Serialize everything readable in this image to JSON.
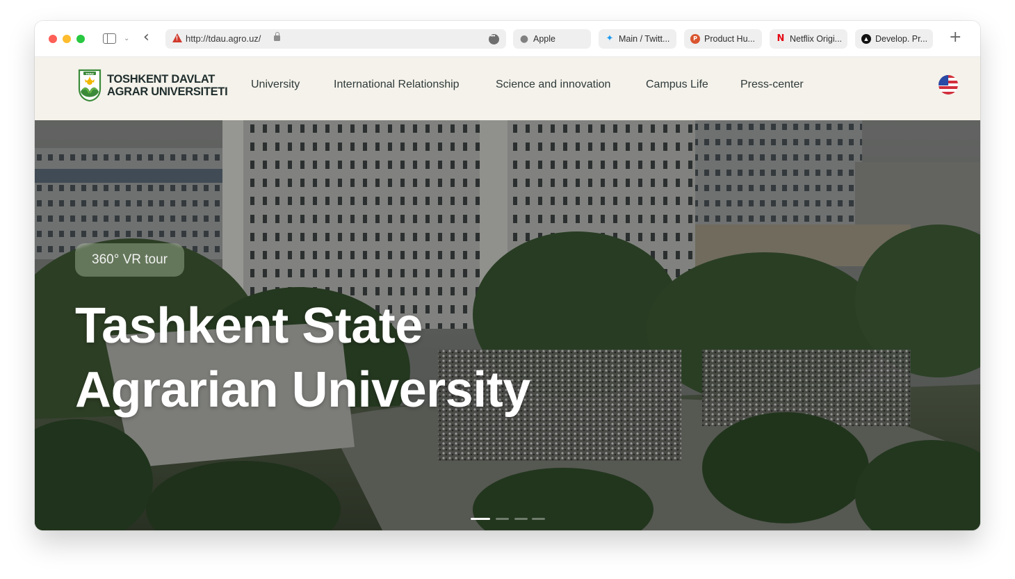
{
  "browser": {
    "url": "http://tdau.agro.uz/",
    "bookmarks": [
      {
        "label": "Apple",
        "icon": "apple-icon"
      },
      {
        "label": "Main / Twitt...",
        "icon": "twitter-icon"
      },
      {
        "label": "Product Hu...",
        "icon": "product-hunt-icon"
      },
      {
        "label": "Netflix Origi...",
        "icon": "netflix-icon"
      },
      {
        "label": "Develop. Pr...",
        "icon": "develop-icon"
      }
    ]
  },
  "site": {
    "logo_line1": "TOSHKENT DAVLAT",
    "logo_line2": "AGRAR UNIVERSITETI",
    "logo_badge": "TDAU",
    "nav": [
      {
        "label": "University"
      },
      {
        "label": "International Relationship"
      },
      {
        "label": "Science and innovation"
      },
      {
        "label": "Campus Life"
      },
      {
        "label": "Press-center"
      }
    ],
    "language_icon": "us-flag-icon"
  },
  "hero": {
    "chip_label": "360° VR tour",
    "title_line1": "Tashkent State",
    "title_line2": "Agrarian University",
    "slides": {
      "count": 4,
      "active": 1
    }
  },
  "colors": {
    "header_bg": "#f4f2ea",
    "accent_green": "#3b8a3a",
    "accent_yellow": "#f2b705",
    "warning_red": "#d13a2d"
  }
}
